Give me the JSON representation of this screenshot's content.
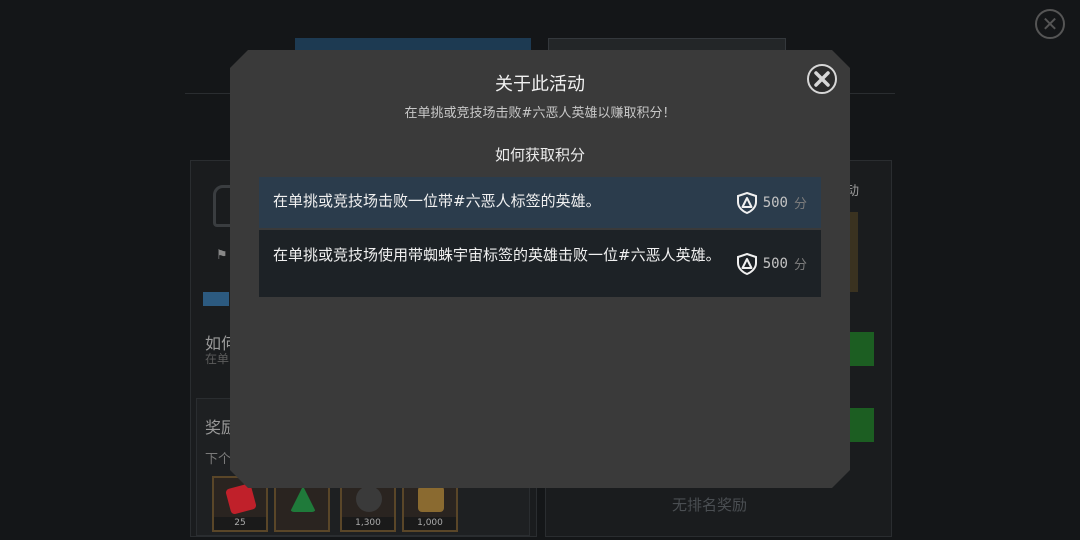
{
  "background": {
    "how_label": "如何",
    "how_sub": "在单",
    "reward_label": "奖励",
    "next_label": "下个",
    "right_label": "动",
    "no_ranking": "无排名奖励",
    "items": [
      {
        "count": "25",
        "color": "#c0202a"
      },
      {
        "count": "",
        "color": "#1f7a3a"
      },
      {
        "count": "1,300",
        "color": "#3a3a3a"
      },
      {
        "count": "1,000",
        "color": "#8a6a30"
      }
    ]
  },
  "modal": {
    "title": "关于此活动",
    "subtitle": "在单挑或竞技场击败#六恶人英雄以赚取积分！",
    "section_heading": "如何获取积分",
    "close_icon": "close-x-circle-icon",
    "tasks": [
      {
        "text": "在单挑或竞技场击败一位带#六恶人标签的英雄。",
        "points": "500",
        "unit": "分",
        "icon": "shield-badge-icon"
      },
      {
        "text": "在单挑或竞技场使用带蜘蛛宇宙标签的英雄击败一位#六恶人英雄。",
        "points": "500",
        "unit": "分",
        "icon": "shield-badge-icon"
      }
    ]
  },
  "colors": {
    "modal_bg": "#3a3a3a",
    "row_highlight": "#2b3c4c",
    "row_dark": "#1d2226"
  }
}
